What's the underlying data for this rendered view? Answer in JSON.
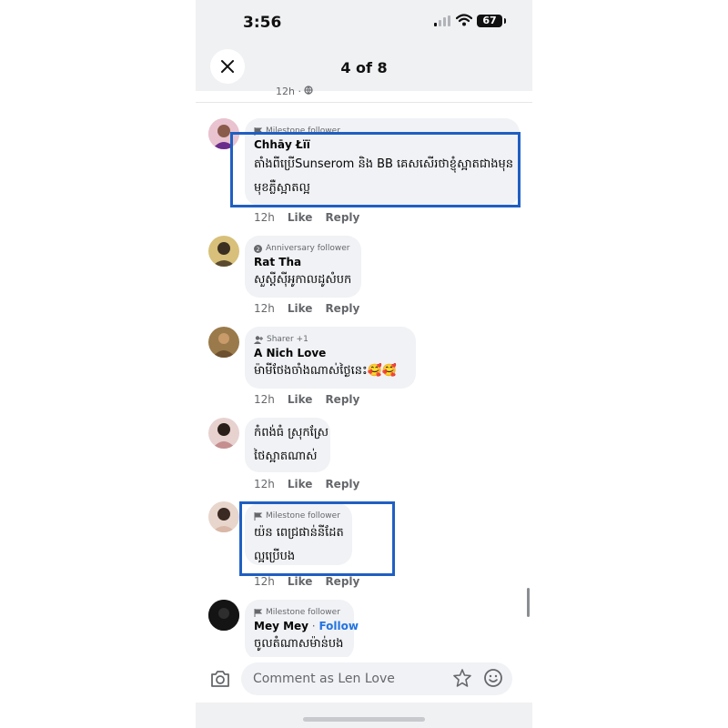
{
  "status_bar": {
    "time": "3:56",
    "battery": "67"
  },
  "header": {
    "page_indicator": "4 of 8",
    "close_icon": "close-icon"
  },
  "top_fragment": {
    "time": "12h ·"
  },
  "comments": [
    {
      "badge": "Milestone follower",
      "badge_icon": "flag-icon",
      "author": "Chhāy Łïï",
      "lines": [
        "តាំងពីប្រើSunserom និង BB គេសសើរថាខ្ញុំស្អាតជាងមុន",
        "មុខភ្លឺស្អាតល្អ"
      ],
      "time": "12h",
      "like": "Like",
      "reply": "Reply",
      "highlighted": true
    },
    {
      "badge": "Anniversary follower",
      "badge_icon": "anniversary-icon",
      "author": "Rat Tha",
      "lines": [
        "សួស្ដីស៊ីអូកាលដូសំបក"
      ],
      "time": "12h",
      "like": "Like",
      "reply": "Reply"
    },
    {
      "badge": "Sharer +1",
      "badge_icon": "sharer-icon",
      "author": "A Nich Love",
      "lines": [
        "ម៉ាមីថែងចាំងណាស់ថ្ងៃនេះ🥰🥰"
      ],
      "time": "12h",
      "like": "Like",
      "reply": "Reply"
    },
    {
      "badge": "",
      "author": "",
      "lines": [
        "កំពង់ធំ ស្រុកស្រែ",
        "ថៃស្អាតណាស់"
      ],
      "time": "12h",
      "like": "Like",
      "reply": "Reply"
    },
    {
      "badge": "Milestone follower",
      "badge_icon": "flag-icon",
      "author": "",
      "lines": [
        "យ៉ន ពេជ្រផាន់នីដែត",
        "ល្អប្រើបង"
      ],
      "time": "12h",
      "like": "Like",
      "reply": "Reply",
      "highlighted": true
    },
    {
      "badge": "Milestone follower",
      "badge_icon": "flag-icon",
      "author": "Mey Mey",
      "follow": "Follow",
      "lines": [
        "ចូលតំណាសម៉ាន់បង"
      ]
    }
  ],
  "footer": {
    "placeholder": "Comment as Len Love"
  },
  "colors": {
    "highlight": "#1f5fc2",
    "bubble": "#f0f2f5",
    "link": "#2374e1"
  }
}
